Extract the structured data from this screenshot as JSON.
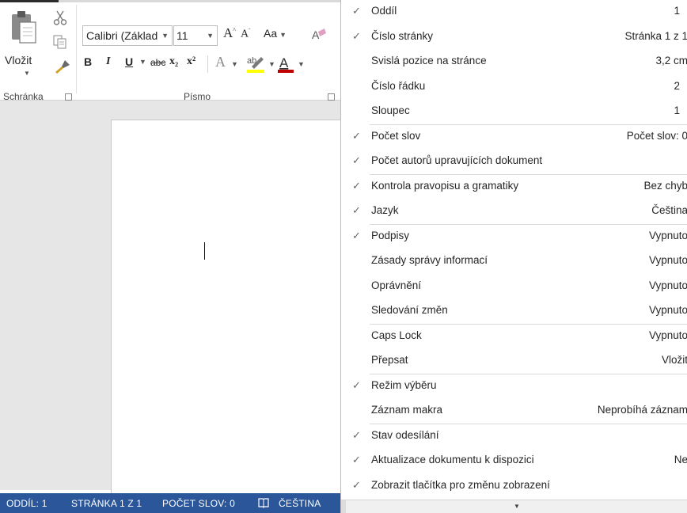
{
  "ribbon": {
    "clipboard": {
      "paste_label": "Vložit",
      "group_label": "Schránka"
    },
    "font": {
      "font_name": "Calibri (Základ",
      "font_size": "11",
      "case_label": "Aa",
      "bold": "B",
      "italic": "I",
      "underline": "U",
      "strike": "abc",
      "subscript": "x₂",
      "superscript": "x²",
      "effect": "A",
      "color_letter": "A",
      "highlight_letters": "ab",
      "group_label": "Písmo"
    }
  },
  "statusbar": {
    "section": "ODDÍL: 1",
    "page": "STRÁNKA 1 Z 1",
    "words": "POČET SLOV: 0",
    "language": "ČEŠTINA"
  },
  "menu": {
    "items": [
      {
        "label": "Oddíl",
        "value": "1",
        "checked": true
      },
      {
        "label": "Číslo stránky",
        "value": "Stránka 1 z 1",
        "checked": true
      },
      {
        "label": "Svislá pozice na stránce",
        "value": "3,2 cm",
        "checked": false
      },
      {
        "label": "Číslo řádku",
        "value": "2",
        "checked": false
      },
      {
        "label": "Sloupec",
        "value": "1",
        "checked": false
      },
      {
        "label": "Počet slov",
        "value": "Počet slov: 0",
        "checked": true
      },
      {
        "label": "Počet autorů upravujících dokument",
        "value": "",
        "checked": true
      },
      {
        "label": "Kontrola pravopisu a gramatiky",
        "value": "Bez chyb",
        "checked": true
      },
      {
        "label": "Jazyk",
        "value": "Čeština",
        "checked": true
      },
      {
        "label": "Podpisy",
        "value": "Vypnuto",
        "checked": true
      },
      {
        "label": "Zásady správy informací",
        "value": "Vypnuto",
        "checked": false
      },
      {
        "label": "Oprávnění",
        "value": "Vypnuto",
        "checked": false
      },
      {
        "label": "Sledování změn",
        "value": "Vypnuto",
        "checked": false
      },
      {
        "label": "Caps Lock",
        "value": "Vypnuto",
        "checked": false
      },
      {
        "label": "Přepsat",
        "value": "Vložit",
        "checked": false
      },
      {
        "label": "Režim výběru",
        "value": "",
        "checked": true
      },
      {
        "label": "Záznam makra",
        "value": "Neprobíhá záznam",
        "checked": false
      },
      {
        "label": "Stav odesílání",
        "value": "",
        "checked": true
      },
      {
        "label": "Aktualizace dokumentu k dispozici",
        "value": "Ne",
        "checked": true
      },
      {
        "label": "Zobrazit tlačítka pro změnu zobrazení",
        "value": "",
        "checked": true
      }
    ],
    "check_glyph": "✓"
  },
  "colors": {
    "statusbar": "#2b579a",
    "font_color_bar": "#c00000",
    "highlight_bar": "#ffff00"
  }
}
